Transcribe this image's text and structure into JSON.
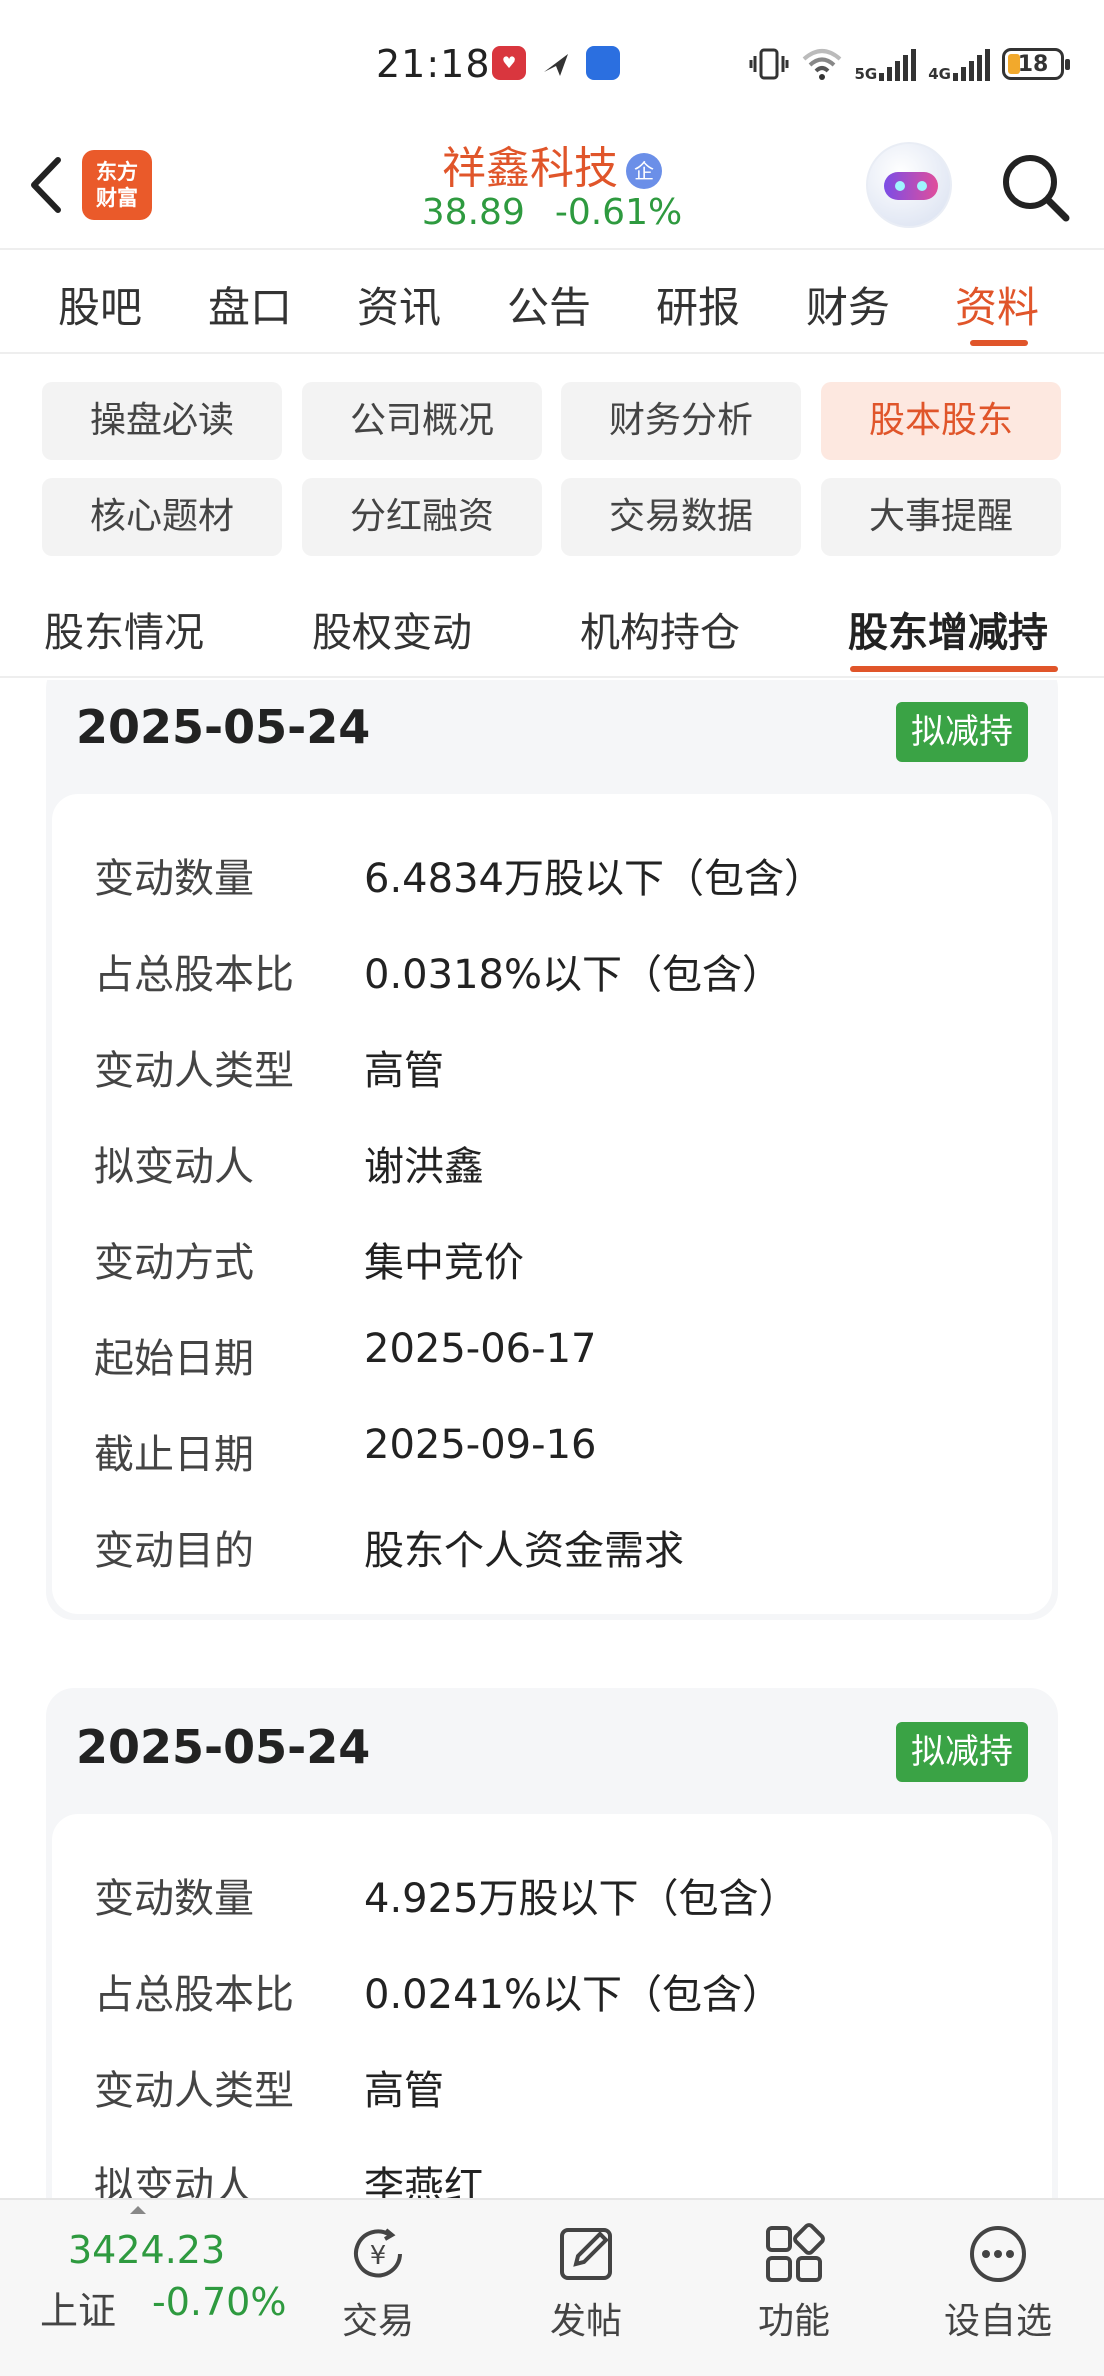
{
  "status_bar": {
    "time": "21:18",
    "network_5g": "5G",
    "network_4g": "4G",
    "battery": "18"
  },
  "header": {
    "logo_line1": "东方",
    "logo_line2": "财富",
    "stock_name": "祥鑫科技",
    "badge": "企",
    "price": "38.89",
    "change_pct": "-0.61%"
  },
  "main_tabs": [
    {
      "label": "股吧"
    },
    {
      "label": "盘口"
    },
    {
      "label": "资讯"
    },
    {
      "label": "公告"
    },
    {
      "label": "研报"
    },
    {
      "label": "财务"
    },
    {
      "label": "资料",
      "active": true
    }
  ],
  "categories": [
    {
      "label": "操盘必读"
    },
    {
      "label": "公司概况"
    },
    {
      "label": "财务分析"
    },
    {
      "label": "股本股东",
      "active": true
    },
    {
      "label": "核心题材"
    },
    {
      "label": "分红融资"
    },
    {
      "label": "交易数据"
    },
    {
      "label": "大事提醒"
    }
  ],
  "sub_tabs": [
    {
      "label": "股东情况"
    },
    {
      "label": "股权变动"
    },
    {
      "label": "机构持仓"
    },
    {
      "label": "股东增减持",
      "active": true
    }
  ],
  "records": [
    {
      "date": "2025-05-24",
      "tag": "拟减持",
      "fields": [
        {
          "label": "变动数量",
          "value": "6.4834万股以下（包含）"
        },
        {
          "label": "占总股本比",
          "value": "0.0318%以下（包含）"
        },
        {
          "label": "变动人类型",
          "value": "高管"
        },
        {
          "label": "拟变动人",
          "value": "谢洪鑫"
        },
        {
          "label": "变动方式",
          "value": "集中竞价"
        },
        {
          "label": "起始日期",
          "value": "2025-06-17"
        },
        {
          "label": "截止日期",
          "value": "2025-09-16"
        },
        {
          "label": "变动目的",
          "value": "股东个人资金需求"
        }
      ]
    },
    {
      "date": "2025-05-24",
      "tag": "拟减持",
      "fields": [
        {
          "label": "变动数量",
          "value": "4.925万股以下（包含）"
        },
        {
          "label": "占总股本比",
          "value": "0.0241%以下（包含）"
        },
        {
          "label": "变动人类型",
          "value": "高管"
        },
        {
          "label": "拟变动人",
          "value": "李燕红"
        }
      ]
    }
  ],
  "bottom_bar": {
    "index_value": "3424.23",
    "index_name": "上证",
    "index_change": "-0.70%",
    "nav": [
      {
        "label": "交易",
        "icon": "trade-yen-icon"
      },
      {
        "label": "发帖",
        "icon": "compose-icon"
      },
      {
        "label": "功能",
        "icon": "grid-icon"
      },
      {
        "label": "设自选",
        "icon": "more-dots-icon"
      }
    ]
  },
  "colors": {
    "accent": "#e0552a",
    "down_green": "#2e9a3f",
    "tag_green": "#3aa345"
  }
}
